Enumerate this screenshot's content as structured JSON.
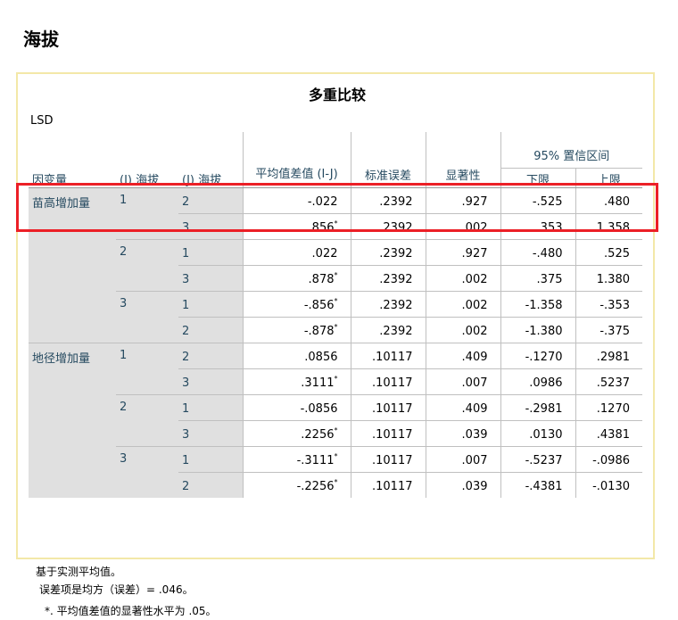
{
  "page_title": "海拔",
  "table_title": "多重比较",
  "method": "LSD",
  "headers": {
    "dependent": "因变量",
    "i_col": "(I) 海拔",
    "j_col": "(J) 海拔",
    "mean_diff": "平均值差值 (I-J)",
    "std_err": "标准误差",
    "sig": "显著性",
    "ci_group": "95% 置信区间",
    "lower": "下限",
    "upper": "上限"
  },
  "groups": [
    {
      "dependent": "苗高增加量",
      "rows": [
        {
          "i": "1",
          "j": "2",
          "mean_diff": "-.022",
          "star": "",
          "std_err": ".2392",
          "sig": ".927",
          "lower": "-.525",
          "upper": ".480"
        },
        {
          "i": "",
          "j": "3",
          "mean_diff": ".856",
          "star": "*",
          "std_err": ".2392",
          "sig": ".002",
          "lower": ".353",
          "upper": "1.358"
        },
        {
          "i": "2",
          "j": "1",
          "mean_diff": ".022",
          "star": "",
          "std_err": ".2392",
          "sig": ".927",
          "lower": "-.480",
          "upper": ".525"
        },
        {
          "i": "",
          "j": "3",
          "mean_diff": ".878",
          "star": "*",
          "std_err": ".2392",
          "sig": ".002",
          "lower": ".375",
          "upper": "1.380"
        },
        {
          "i": "3",
          "j": "1",
          "mean_diff": "-.856",
          "star": "*",
          "std_err": ".2392",
          "sig": ".002",
          "lower": "-1.358",
          "upper": "-.353"
        },
        {
          "i": "",
          "j": "2",
          "mean_diff": "-.878",
          "star": "*",
          "std_err": ".2392",
          "sig": ".002",
          "lower": "-1.380",
          "upper": "-.375"
        }
      ]
    },
    {
      "dependent": "地径增加量",
      "rows": [
        {
          "i": "1",
          "j": "2",
          "mean_diff": ".0856",
          "star": "",
          "std_err": ".10117",
          "sig": ".409",
          "lower": "-.1270",
          "upper": ".2981"
        },
        {
          "i": "",
          "j": "3",
          "mean_diff": ".3111",
          "star": "*",
          "std_err": ".10117",
          "sig": ".007",
          "lower": ".0986",
          "upper": ".5237"
        },
        {
          "i": "2",
          "j": "1",
          "mean_diff": "-.0856",
          "star": "",
          "std_err": ".10117",
          "sig": ".409",
          "lower": "-.2981",
          "upper": ".1270"
        },
        {
          "i": "",
          "j": "3",
          "mean_diff": ".2256",
          "star": "*",
          "std_err": ".10117",
          "sig": ".039",
          "lower": ".0130",
          "upper": ".4381"
        },
        {
          "i": "3",
          "j": "1",
          "mean_diff": "-.3111",
          "star": "*",
          "std_err": ".10117",
          "sig": ".007",
          "lower": "-.5237",
          "upper": "-.0986"
        },
        {
          "i": "",
          "j": "2",
          "mean_diff": "-.2256",
          "star": "*",
          "std_err": ".10117",
          "sig": ".039",
          "lower": "-.4381",
          "upper": "-.0130"
        }
      ]
    }
  ],
  "footnotes": [
    "基于实测平均值。",
    "误差项是均方（误差）= .046。",
    "*. 平均值差值的显著性水平为 .05。"
  ],
  "colors": {
    "label_text": "#264a60",
    "label_bg": "#e0e0e0",
    "frame": "#f3e8a8",
    "highlight": "#ec1f26"
  }
}
